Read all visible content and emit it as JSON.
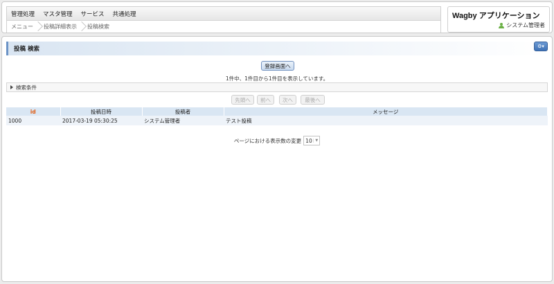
{
  "menu": [
    "管理処理",
    "マスタ管理",
    "サービス",
    "共通処理"
  ],
  "breadcrumbs": [
    "メニュー",
    "投稿詳細表示",
    "投稿検索"
  ],
  "app": {
    "title": "Wagby アプリケーション",
    "user": "システム管理者"
  },
  "page": {
    "title": "投稿 検索",
    "register_button": "登録画面へ",
    "result_info": "1件中、1件目から1件目を表示しています。",
    "search_conditions": "検索条件",
    "pager": {
      "first": "先頭へ",
      "prev": "前へ",
      "next": "次へ",
      "last": "最後へ"
    },
    "table": {
      "headers": [
        "id",
        "投稿日時",
        "投稿者",
        "メッセージ"
      ],
      "rows": [
        [
          "1000",
          "2017-03-19 05:30:25",
          "システム管理者",
          "テスト投稿"
        ]
      ]
    },
    "page_size_label": "ページにおける表示数の変更",
    "page_size_value": "10",
    "colors": {
      "accent": "#6b93c6",
      "id_header": "#e05a10",
      "header_bg": "#d9e6f3"
    }
  }
}
